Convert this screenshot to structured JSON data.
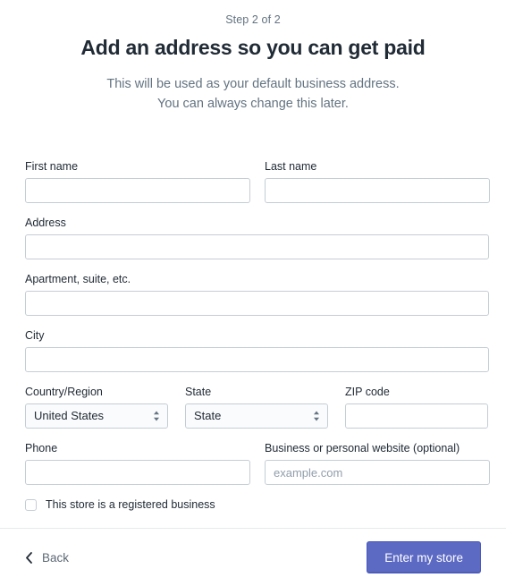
{
  "header": {
    "step_label": "Step 2 of 2",
    "title": "Add an address so you can get paid",
    "subtitle_line1": "This will be used as your default business address.",
    "subtitle_line2": "You can always change this later."
  },
  "form": {
    "first_name": {
      "label": "First name",
      "value": "",
      "placeholder": ""
    },
    "last_name": {
      "label": "Last name",
      "value": "",
      "placeholder": ""
    },
    "address": {
      "label": "Address",
      "value": "",
      "placeholder": ""
    },
    "apartment": {
      "label": "Apartment, suite, etc.",
      "value": "",
      "placeholder": ""
    },
    "city": {
      "label": "City",
      "value": "",
      "placeholder": ""
    },
    "country": {
      "label": "Country/Region",
      "value": "United States"
    },
    "state": {
      "label": "State",
      "value": "State"
    },
    "zip": {
      "label": "ZIP code",
      "value": "",
      "placeholder": ""
    },
    "phone": {
      "label": "Phone",
      "value": "",
      "placeholder": ""
    },
    "website": {
      "label": "Business or personal website (optional)",
      "value": "",
      "placeholder": "example.com"
    },
    "registered_business": {
      "label": "This store is a registered business",
      "checked": false
    }
  },
  "footer": {
    "back_label": "Back",
    "submit_label": "Enter my store"
  },
  "colors": {
    "primary": "#5c6ac4",
    "text": "#212b36",
    "muted": "#637381",
    "border": "#c4cdd5"
  }
}
